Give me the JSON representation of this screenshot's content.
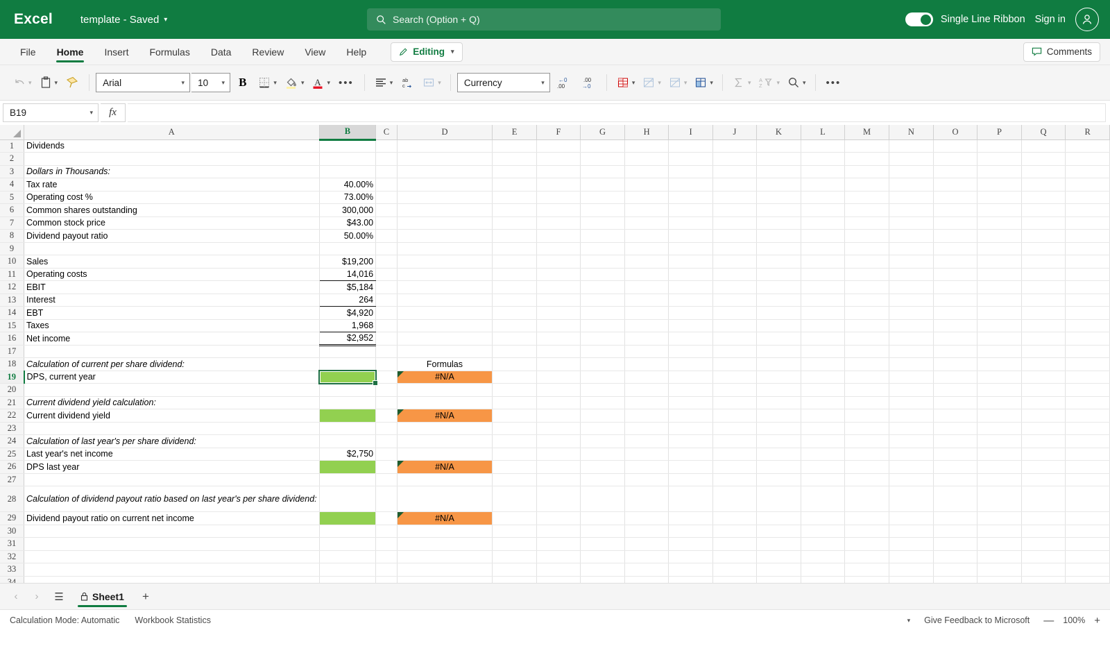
{
  "titlebar": {
    "app_name": "Excel",
    "doc_title": "template  -  Saved",
    "search_placeholder": "Search (Option + Q)",
    "ribbon_toggle_label": "Single Line Ribbon",
    "sign_in": "Sign in",
    "brand_color": "#107C41"
  },
  "ribbon_tabs": {
    "tabs": [
      "File",
      "Home",
      "Insert",
      "Formulas",
      "Data",
      "Review",
      "View",
      "Help"
    ],
    "active": "Home",
    "editing_label": "Editing",
    "comments_label": "Comments"
  },
  "ribbon": {
    "undo": "undo-icon",
    "paste": "paste-icon",
    "format_painter": "format-painter-icon",
    "font_name": "Arial",
    "font_size": "10",
    "bold_label": "B",
    "borders": "borders-icon",
    "fill_color": "fill-color-icon",
    "font_color": "font-color-icon",
    "more_font": "•••",
    "align": "align-icon",
    "wrap_text": "wrap-text-icon",
    "merge": "merge-cells-icon",
    "number_format": "Currency",
    "decrease_decimal": "decrease-decimal-icon",
    "increase_decimal": "increase-decimal-icon",
    "conditional_formatting": "conditional-formatting-icon",
    "format_table": "format-as-table-icon",
    "cell_styles": "cell-styles-icon",
    "insert_cells": "insert-cells-icon",
    "autosum": "autosum-icon",
    "sort_filter": "sort-filter-icon",
    "find": "find-icon",
    "more": "•••"
  },
  "formula_bar": {
    "name_box": "B19",
    "fx_label": "fx",
    "formula_value": ""
  },
  "grid": {
    "columns": [
      "A",
      "B",
      "C",
      "D",
      "E",
      "F",
      "G",
      "H",
      "I",
      "J",
      "K",
      "L",
      "M",
      "N",
      "O",
      "P",
      "Q",
      "R"
    ],
    "selected_column": "B",
    "selected_cell": "B19",
    "rows": [
      {
        "n": "1",
        "a": "Dividends",
        "a_style": "b"
      },
      {
        "n": "2",
        "a": ""
      },
      {
        "n": "3",
        "a": "Dollars in Thousands:",
        "a_style": "i"
      },
      {
        "n": "4",
        "a": "Tax rate",
        "b": "40.00%"
      },
      {
        "n": "5",
        "a": "Operating cost %",
        "b": "73.00%"
      },
      {
        "n": "6",
        "a": "Common shares outstanding",
        "b": "300,000"
      },
      {
        "n": "7",
        "a": "Common stock price",
        "b": "$43.00"
      },
      {
        "n": "8",
        "a": "Dividend payout ratio",
        "b": "50.00%"
      },
      {
        "n": "9",
        "a": ""
      },
      {
        "n": "10",
        "a": "Sales",
        "b": "$19,200"
      },
      {
        "n": "11",
        "a": "Operating costs",
        "b": "14,016",
        "b_border": "single"
      },
      {
        "n": "12",
        "a": "EBIT",
        "b": "$5,184"
      },
      {
        "n": "13",
        "a": "Interest",
        "b": "264",
        "b_border": "single"
      },
      {
        "n": "14",
        "a": "EBT",
        "b": "$4,920"
      },
      {
        "n": "15",
        "a": "Taxes",
        "b": "1,968",
        "b_border": "single"
      },
      {
        "n": "16",
        "a": "Net income",
        "b": "$2,952",
        "b_border": "double"
      },
      {
        "n": "17",
        "a": ""
      },
      {
        "n": "18",
        "a": "Calculation of current per share dividend:",
        "a_style": "bi",
        "d": "Formulas",
        "d_style": "b c"
      },
      {
        "n": "19",
        "a": "DPS, current year",
        "b": "",
        "b_fill": "green",
        "d": "#N/A",
        "d_fill": "orange"
      },
      {
        "n": "20",
        "a": ""
      },
      {
        "n": "21",
        "a": "Current dividend yield calculation:",
        "a_style": "bi"
      },
      {
        "n": "22",
        "a": "Current dividend yield",
        "b": "",
        "b_fill": "green",
        "d": "#N/A",
        "d_fill": "orange"
      },
      {
        "n": "23",
        "a": ""
      },
      {
        "n": "24",
        "a": "Calculation of last year's per share dividend:",
        "a_style": "bi"
      },
      {
        "n": "25",
        "a": "Last year's net income",
        "b": "$2,750"
      },
      {
        "n": "26",
        "a": "DPS last year",
        "b": "",
        "b_fill": "green",
        "d": "#N/A",
        "d_fill": "orange"
      },
      {
        "n": "27",
        "a": ""
      },
      {
        "n": "28",
        "a": "Calculation of dividend payout ratio based\non last year's per share dividend:",
        "a_style": "bi",
        "tall": true
      },
      {
        "n": "29",
        "a": "Dividend payout ratio on current net income",
        "b": "",
        "b_fill": "green",
        "d": "#N/A",
        "d_fill": "orange"
      },
      {
        "n": "30",
        "a": ""
      },
      {
        "n": "31",
        "a": ""
      },
      {
        "n": "32",
        "a": ""
      },
      {
        "n": "33",
        "a": ""
      },
      {
        "n": "34",
        "a": ""
      }
    ],
    "fill_green": "#92D050",
    "fill_orange": "#F79646"
  },
  "sheet_tabs": {
    "prev": "‹",
    "next": "›",
    "all_sheets": "sheet-list-icon",
    "name": "Sheet1",
    "locked": true,
    "add": "+"
  },
  "statusbar": {
    "calc_mode": "Calculation Mode: Automatic",
    "workbook_stats": "Workbook Statistics",
    "feedback": "Give Feedback to Microsoft",
    "zoom_out": "—",
    "zoom_level": "100%",
    "zoom_in": "+"
  }
}
